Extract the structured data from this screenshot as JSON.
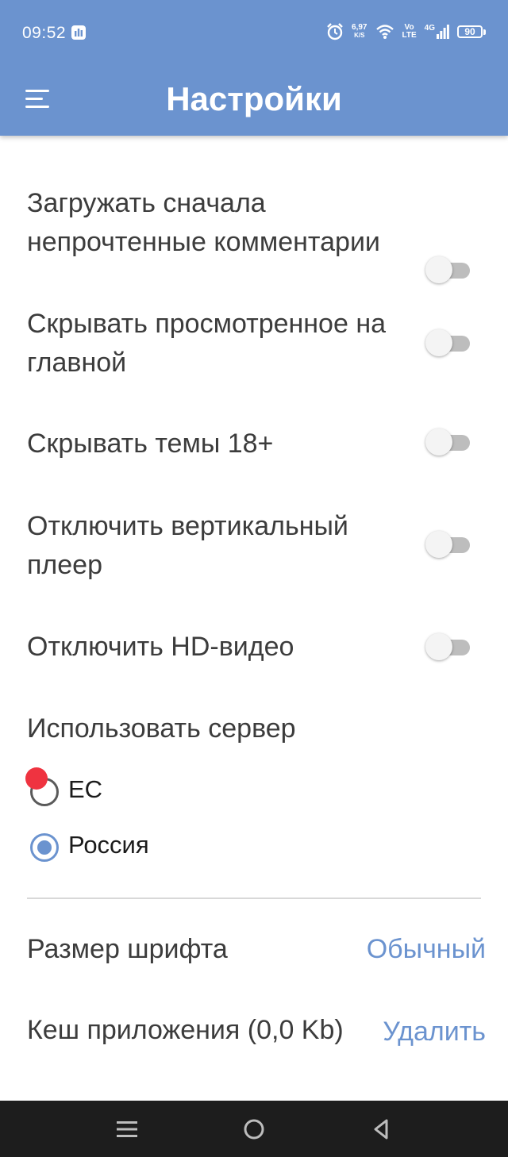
{
  "colors": {
    "accent": "#6b93cf"
  },
  "status_bar": {
    "time": "09:52",
    "app_icon": "app-notification-icon",
    "net_speed": "6,97",
    "net_speed_unit": "K/S",
    "volte_top": "Vo",
    "volte_bottom": "LTE",
    "network": "4G",
    "battery": "90"
  },
  "toolbar": {
    "title": "Настройки",
    "menu_icon": "hamburger-menu-icon"
  },
  "settings": {
    "items": [
      {
        "label": "Загружать сначала непрочтенные комментарии",
        "enabled": false
      },
      {
        "label": "Скрывать просмотренное на главной",
        "enabled": false
      },
      {
        "label": "Скрывать темы 18+",
        "enabled": false
      },
      {
        "label": "Отключить вертикальный плеер",
        "enabled": false
      },
      {
        "label": "Отключить HD-видео",
        "enabled": false
      }
    ],
    "server": {
      "title": "Использовать сервер",
      "options": [
        {
          "label": "ЕС",
          "selected": false
        },
        {
          "label": "Россия",
          "selected": true
        }
      ]
    },
    "font_size": {
      "label": "Размер шрифта",
      "value": "Обычный"
    },
    "cache": {
      "label": "Кеш приложения (0,0 Kb)",
      "action": "Удалить"
    }
  },
  "nav_bar": {
    "icons": [
      "recent-apps-icon",
      "home-icon",
      "back-icon"
    ]
  }
}
